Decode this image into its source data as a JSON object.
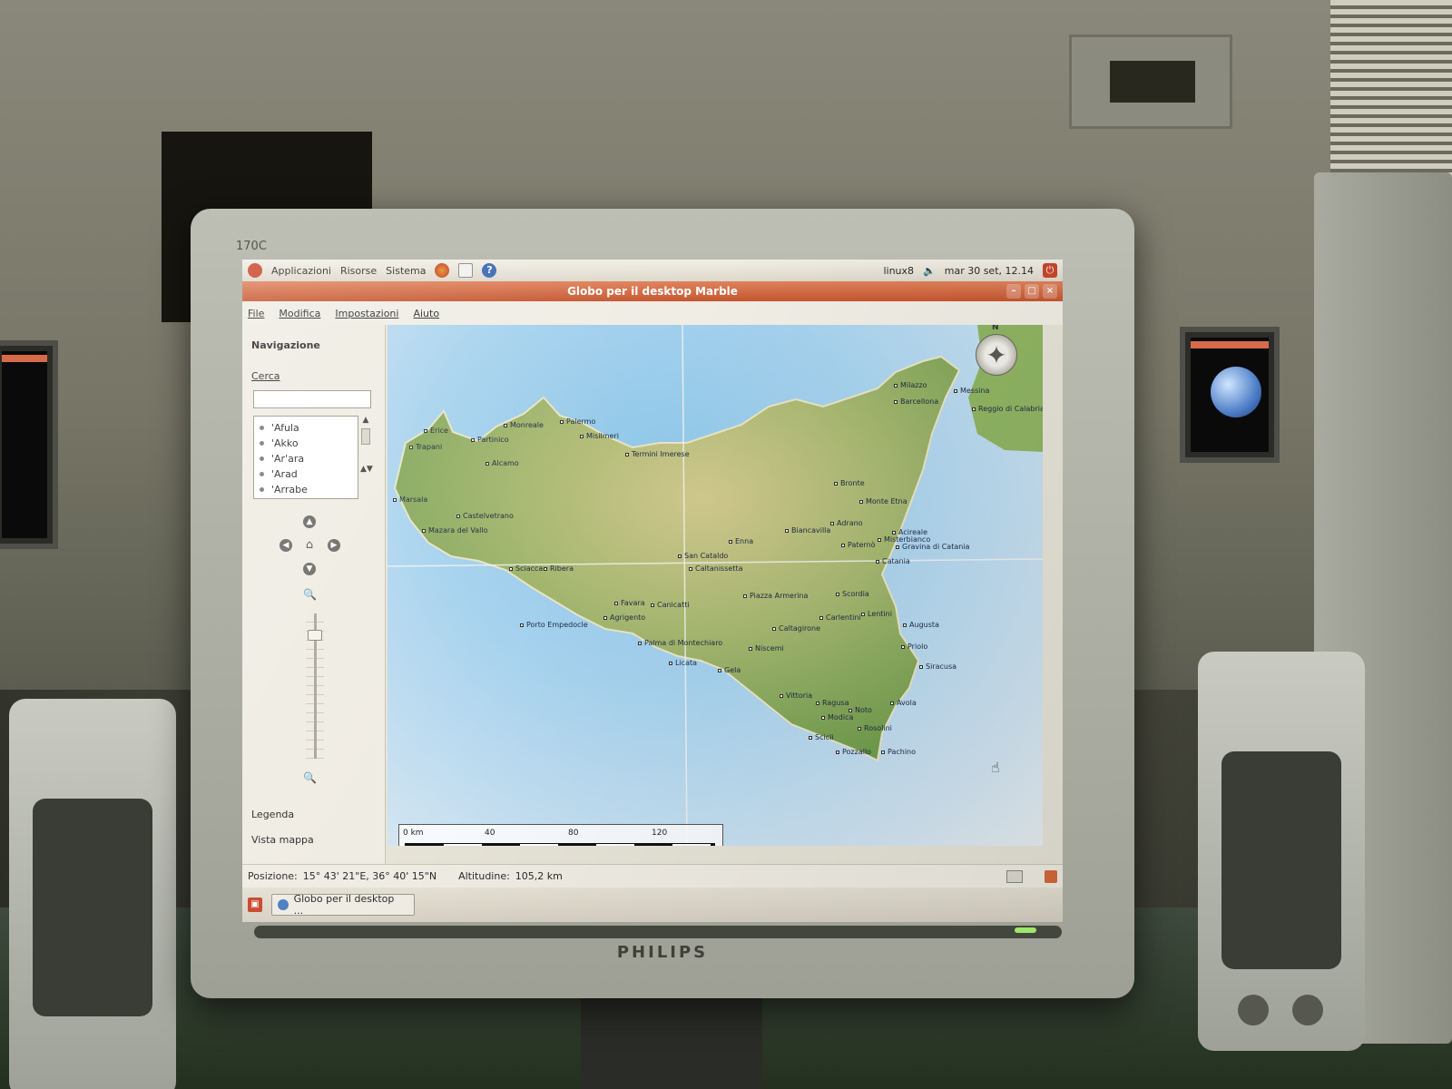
{
  "monitor": {
    "model": "170C",
    "brand": "PHILIPS"
  },
  "top_panel": {
    "menus": [
      "Applicazioni",
      "Risorse",
      "Sistema"
    ],
    "username": "linux8",
    "clock": "mar 30 set, 12.14"
  },
  "window": {
    "title": "Globo per il desktop Marble",
    "menu": [
      "File",
      "Modifica",
      "Impostazioni",
      "Aiuto"
    ]
  },
  "sidebar": {
    "heading": "Navigazione",
    "search_label": "Cerca",
    "search_value": "",
    "results": [
      "'Afula",
      "'Akko",
      "'Ar'ara",
      "'Arad",
      "'Arrabe"
    ],
    "tabs": [
      "Legenda",
      "Vista mappa"
    ]
  },
  "map": {
    "compass_label": "N",
    "scale_labels": [
      "0 km",
      "40",
      "80",
      "120"
    ],
    "cities": [
      "Erice",
      "Trapani",
      "Partinico",
      "Monreale",
      "Palermo",
      "Misilmeri",
      "Termini Imerese",
      "Alcamo",
      "Marsala",
      "Castelvetrano",
      "Mazara del Vallo",
      "Sciacca",
      "Ribera",
      "Porto Empedocle",
      "Agrigento",
      "Favara",
      "Canicatti",
      "Palma di Montechiaro",
      "Licata",
      "Gela",
      "San Cataldo",
      "Caltanissetta",
      "Enna",
      "Piazza Armerina",
      "Caltagirone",
      "Niscemi",
      "Vittoria",
      "Ragusa",
      "Modica",
      "Scicli",
      "Pozzallo",
      "Noto",
      "Rosolini",
      "Pachino",
      "Avola",
      "Siracusa",
      "Priolo",
      "Augusta",
      "Lentini",
      "Scordia",
      "Carlentini",
      "Biancavilla",
      "Adrano",
      "Bronte",
      "Monte Etna",
      "Paternò",
      "Misterbianco",
      "Gravina di Catania",
      "Catania",
      "Acireale",
      "Milazzo",
      "Barcellona",
      "Messina",
      "Reggio di Calabria"
    ]
  },
  "status": {
    "position_label": "Posizione:",
    "position_value": "15° 43' 21\"E,  36° 40' 15\"N",
    "altitude_label": "Altitudine:",
    "altitude_value": "105,2 km"
  },
  "taskbar": {
    "task_label": "Globo per il desktop ..."
  },
  "colors": {
    "accent": "#c55630",
    "land": "#8fb462",
    "sea": "#a6d2ee"
  }
}
